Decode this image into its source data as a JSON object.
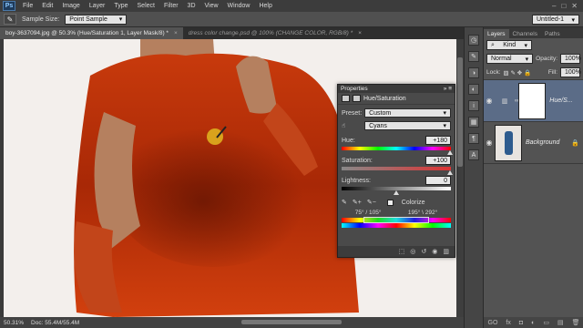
{
  "menubar": {
    "logo": "Ps",
    "items": [
      "File",
      "Edit",
      "Image",
      "Layer",
      "Type",
      "Select",
      "Filter",
      "3D",
      "View",
      "Window",
      "Help"
    ],
    "window_controls": [
      "–",
      "□",
      "✕"
    ]
  },
  "options": {
    "sample_size_label": "Sample Size:",
    "sample_size_value": "Point Sample",
    "workspace": "Untitled-1"
  },
  "tabs": [
    {
      "label": "boy-3637094.jpg @ 50.3% (Hue/Saturation 1, Layer Mask/8) *",
      "close": "×"
    },
    {
      "label": "dress color change.psd @ 100% (CHANGE COLOR, RGB/8) *",
      "close": "×"
    }
  ],
  "status": {
    "zoom": "50.31%",
    "doc": "Doc: 55.4M/55.4M"
  },
  "layers_panel": {
    "tabs": [
      "Layers",
      "Channels",
      "Paths"
    ],
    "kind": "Kind",
    "blend_mode": "Normal",
    "opacity_label": "Opacity:",
    "opacity_value": "100%",
    "lock_label": "Lock:",
    "fill_label": "Fill:",
    "fill_value": "100%",
    "layers": [
      {
        "name": "Hue/S..."
      },
      {
        "name": "Background"
      }
    ],
    "bottom_icons": [
      "GO",
      "fx",
      "◘",
      "◐",
      "▭",
      "▤",
      "🗑"
    ]
  },
  "properties": {
    "title": "Properties",
    "panel_name": "Hue/Saturation",
    "preset_label": "Preset:",
    "preset_value": "Custom",
    "channel_value": "Cyans",
    "hue_label": "Hue:",
    "hue_value": "+180",
    "saturation_label": "Saturation:",
    "saturation_value": "+100",
    "lightness_label": "Lightness:",
    "lightness_value": "0",
    "colorize_label": "Colorize",
    "range_left": "75° / 105°",
    "range_right": "195° \\ 292°"
  }
}
